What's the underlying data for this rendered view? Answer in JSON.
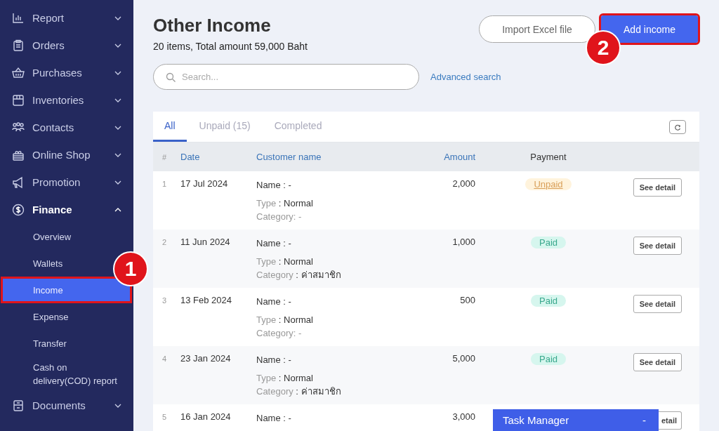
{
  "sidebar": {
    "items": [
      {
        "label": "Report",
        "expanded": false
      },
      {
        "label": "Orders",
        "expanded": false
      },
      {
        "label": "Purchases",
        "expanded": false
      },
      {
        "label": "Inventories",
        "expanded": false
      },
      {
        "label": "Contacts",
        "expanded": false
      },
      {
        "label": "Online Shop",
        "expanded": false
      },
      {
        "label": "Promotion",
        "expanded": false
      },
      {
        "label": "Finance",
        "expanded": true,
        "children": [
          {
            "label": "Overview",
            "selected": false,
            "highlighted": false
          },
          {
            "label": "Wallets",
            "selected": false,
            "highlighted": false
          },
          {
            "label": "Income",
            "selected": true,
            "highlighted": true
          },
          {
            "label": "Expense",
            "selected": false,
            "highlighted": false
          },
          {
            "label": "Transfer",
            "selected": false,
            "highlighted": false
          },
          {
            "label": "Cash on delivery(COD) report",
            "selected": false,
            "highlighted": false
          }
        ]
      },
      {
        "label": "Documents",
        "expanded": false
      }
    ]
  },
  "header": {
    "title": "Other Income",
    "summary": "20 items, Total amount 59,000 Baht",
    "buttons": [
      {
        "label": "Import Excel file",
        "kind": "secondary"
      },
      {
        "label": "Add income",
        "kind": "primary",
        "highlighted": true
      }
    ]
  },
  "search": {
    "placeholder": "Search...",
    "advanced_link": "Advanced search"
  },
  "tabs": [
    {
      "label": "All",
      "selected": true
    },
    {
      "label": "Unpaid (15)",
      "selected": false
    },
    {
      "label": "Completed",
      "selected": false
    }
  ],
  "table": {
    "columns": [
      "#",
      "Date",
      "Customer name",
      "Amount",
      "Payment"
    ],
    "rows": [
      {
        "number": "1",
        "date": "17 Jul 2024",
        "lines": [
          {
            "kind": "plain",
            "text": "Name : -"
          },
          {
            "kind": "labeled",
            "label": "Type",
            "value": ": Normal"
          },
          {
            "kind": "muted",
            "text": "Category: -"
          }
        ],
        "amount": "2,000",
        "payment": {
          "label": "Unpaid",
          "kind": "unpaid"
        },
        "action": "See detail"
      },
      {
        "number": "2",
        "date": "11 Jun 2024",
        "lines": [
          {
            "kind": "plain",
            "text": "Name : -"
          },
          {
            "kind": "labeled",
            "label": "Type",
            "value": ": Normal"
          },
          {
            "kind": "labeled",
            "label": "Category",
            "value": ": ค่าสมาชิก"
          }
        ],
        "amount": "1,000",
        "payment": {
          "label": "Paid",
          "kind": "paid"
        },
        "action": "See detail"
      },
      {
        "number": "3",
        "date": "13 Feb 2024",
        "lines": [
          {
            "kind": "plain",
            "text": "Name : -"
          },
          {
            "kind": "labeled",
            "label": "Type",
            "value": ": Normal"
          },
          {
            "kind": "muted",
            "text": "Category: -"
          }
        ],
        "amount": "500",
        "payment": {
          "label": "Paid",
          "kind": "paid"
        },
        "action": "See detail"
      },
      {
        "number": "4",
        "date": "23 Jan 2024",
        "lines": [
          {
            "kind": "plain",
            "text": "Name : -"
          },
          {
            "kind": "labeled",
            "label": "Type",
            "value": ": Normal"
          },
          {
            "kind": "labeled",
            "label": "Category",
            "value": ": ค่าสมาชิก"
          }
        ],
        "amount": "5,000",
        "payment": {
          "label": "Paid",
          "kind": "paid"
        },
        "action": "See detail"
      },
      {
        "number": "5",
        "date": "16 Jan 2024",
        "lines": [
          {
            "kind": "plain",
            "text": "Name : -"
          }
        ],
        "amount": "3,000",
        "action": "etail"
      }
    ]
  },
  "task_manager": {
    "title": "Task Manager",
    "toggle": "-"
  },
  "annotations": [
    {
      "label": "1"
    },
    {
      "label": "2"
    }
  ]
}
